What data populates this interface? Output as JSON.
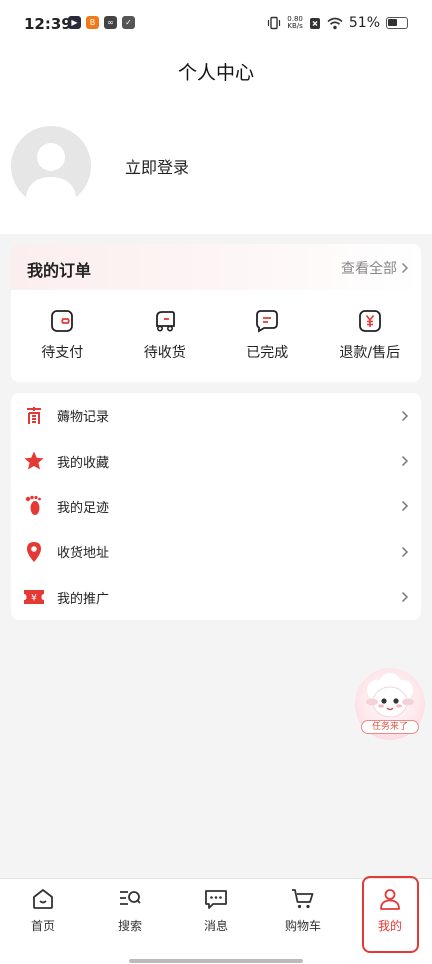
{
  "status_bar": {
    "time": "12:39",
    "net_speed_value": "0.80",
    "net_speed_unit": "KB/s",
    "battery": "51%"
  },
  "header": {
    "title": "个人中心",
    "login_label": "立即登录"
  },
  "orders": {
    "title": "我的订单",
    "view_all": "查看全部",
    "items": [
      {
        "label": "待支付",
        "icon": "wallet-icon"
      },
      {
        "label": "待收货",
        "icon": "truck-icon"
      },
      {
        "label": "已完成",
        "icon": "message-check-icon"
      },
      {
        "label": "退款/售后",
        "icon": "yen-refund-icon"
      }
    ]
  },
  "menu": {
    "items": [
      {
        "label": "薅物记录",
        "icon": "record-icon"
      },
      {
        "label": "我的收藏",
        "icon": "star-icon"
      },
      {
        "label": "我的足迹",
        "icon": "footprint-icon"
      },
      {
        "label": "收货地址",
        "icon": "location-pin-icon"
      },
      {
        "label": "我的推广",
        "icon": "promotion-ticket-icon"
      }
    ]
  },
  "float_badge": {
    "label": "任务来了"
  },
  "tabbar": {
    "items": [
      {
        "label": "首页",
        "icon": "home-icon"
      },
      {
        "label": "搜索",
        "icon": "search-icon"
      },
      {
        "label": "消息",
        "icon": "message-icon"
      },
      {
        "label": "购物车",
        "icon": "cart-icon"
      },
      {
        "label": "我的",
        "icon": "profile-icon",
        "active": true
      }
    ]
  },
  "colors": {
    "accent": "#e53935",
    "background": "#f4f4f4"
  }
}
